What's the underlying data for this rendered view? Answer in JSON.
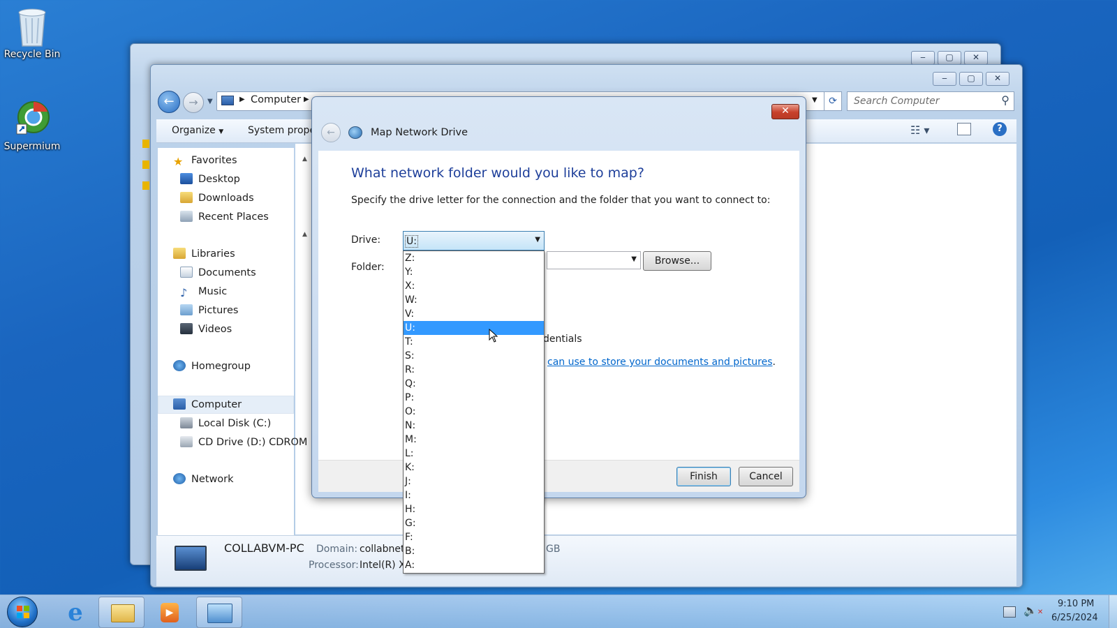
{
  "desktop": {
    "icons": [
      {
        "label": "Recycle Bin"
      },
      {
        "label": "Supermium"
      }
    ]
  },
  "explorer": {
    "breadcrumb": "Computer",
    "search_placeholder": "Search Computer",
    "toolbar": {
      "organize": "Organize",
      "system_properties": "System prope"
    },
    "nav": {
      "favorites": "Favorites",
      "desktop": "Desktop",
      "downloads": "Downloads",
      "recent_places": "Recent Places",
      "libraries": "Libraries",
      "documents": "Documents",
      "music": "Music",
      "pictures": "Pictures",
      "videos": "Videos",
      "homegroup": "Homegroup",
      "computer": "Computer",
      "local_disk": "Local Disk (C:)",
      "cd_drive": "CD Drive (D:) CDROM",
      "network": "Network"
    },
    "details": {
      "pc_name": "COLLABVM-PC",
      "domain_label": "Domain:",
      "domain_value": "collabnet",
      "processor_label": "Processor:",
      "processor_value": "Intel(R) X",
      "memory_fragment": "GB"
    }
  },
  "dialog": {
    "title": "Map Network Drive",
    "heading": "What network folder would you like to map?",
    "instruction": "Specify the drive letter for the connection and the folder that you want to connect to:",
    "drive_label": "Drive:",
    "drive_value": "U:",
    "folder_label": "Folder:",
    "browse_button": "Browse...",
    "credentials_fragment": "dentials",
    "link_fragment": "can use to store your documents and pictures",
    "link_period": ".",
    "finish_button": "Finish",
    "cancel_button": "Cancel",
    "drive_options": [
      "Z:",
      "Y:",
      "X:",
      "W:",
      "V:",
      "U:",
      "T:",
      "S:",
      "R:",
      "Q:",
      "P:",
      "O:",
      "N:",
      "M:",
      "L:",
      "K:",
      "J:",
      "I:",
      "H:",
      "G:",
      "F:",
      "B:",
      "A:"
    ],
    "selected_option": "U:"
  },
  "taskbar": {
    "time": "9:10 PM",
    "date": "6/25/2024"
  },
  "colors": {
    "heading": "#1e3f9a",
    "link": "#0066cc",
    "selection": "#3399ff"
  }
}
